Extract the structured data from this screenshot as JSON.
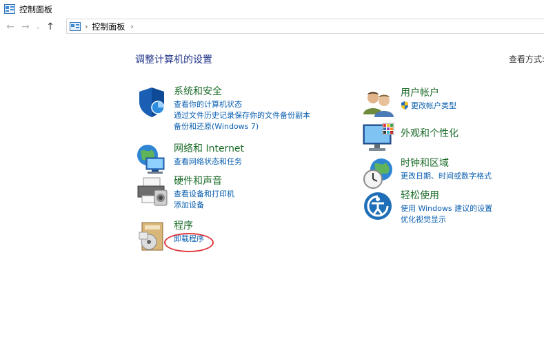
{
  "window": {
    "title": "控制面板"
  },
  "nav": {
    "back": "←",
    "forward": "→",
    "recent": "⌄",
    "up": "↑"
  },
  "address": {
    "separator1": "›",
    "crumb": "控制面板",
    "separator2": "›"
  },
  "main": {
    "heading": "调整计算机的设置",
    "view_by": "查看方式:"
  },
  "categories": {
    "system": {
      "title": "系统和安全",
      "links": [
        "查看你的计算机状态",
        "通过文件历史记录保存你的文件备份副本",
        "备份和还原(Windows 7)"
      ],
      "icon": "shield-icon"
    },
    "network": {
      "title": "网络和 Internet",
      "links": [
        "查看网络状态和任务"
      ],
      "icon": "network-globe-icon"
    },
    "hardware": {
      "title": "硬件和声音",
      "links": [
        "查看设备和打印机",
        "添加设备"
      ],
      "icon": "printer-icon"
    },
    "programs": {
      "title": "程序",
      "links": [
        "卸载程序"
      ],
      "icon": "programs-disc-icon"
    },
    "users": {
      "title": "用户帐户",
      "links": [
        "更改帐户类型"
      ],
      "icon": "users-icon"
    },
    "appearance": {
      "title": "外观和个性化",
      "links": [],
      "icon": "monitor-palette-icon"
    },
    "clock": {
      "title": "时钟和区域",
      "links": [
        "更改日期、时间或数字格式"
      ],
      "icon": "clock-globe-icon"
    },
    "ease": {
      "title": "轻松使用",
      "links": [
        "使用 Windows 建议的设置",
        "优化视觉显示"
      ],
      "icon": "ease-of-access-icon"
    }
  },
  "colors": {
    "heading": "#1e3287",
    "category_title": "#1b6b28",
    "link": "#0a5fb0",
    "highlight": "#e0393e"
  }
}
